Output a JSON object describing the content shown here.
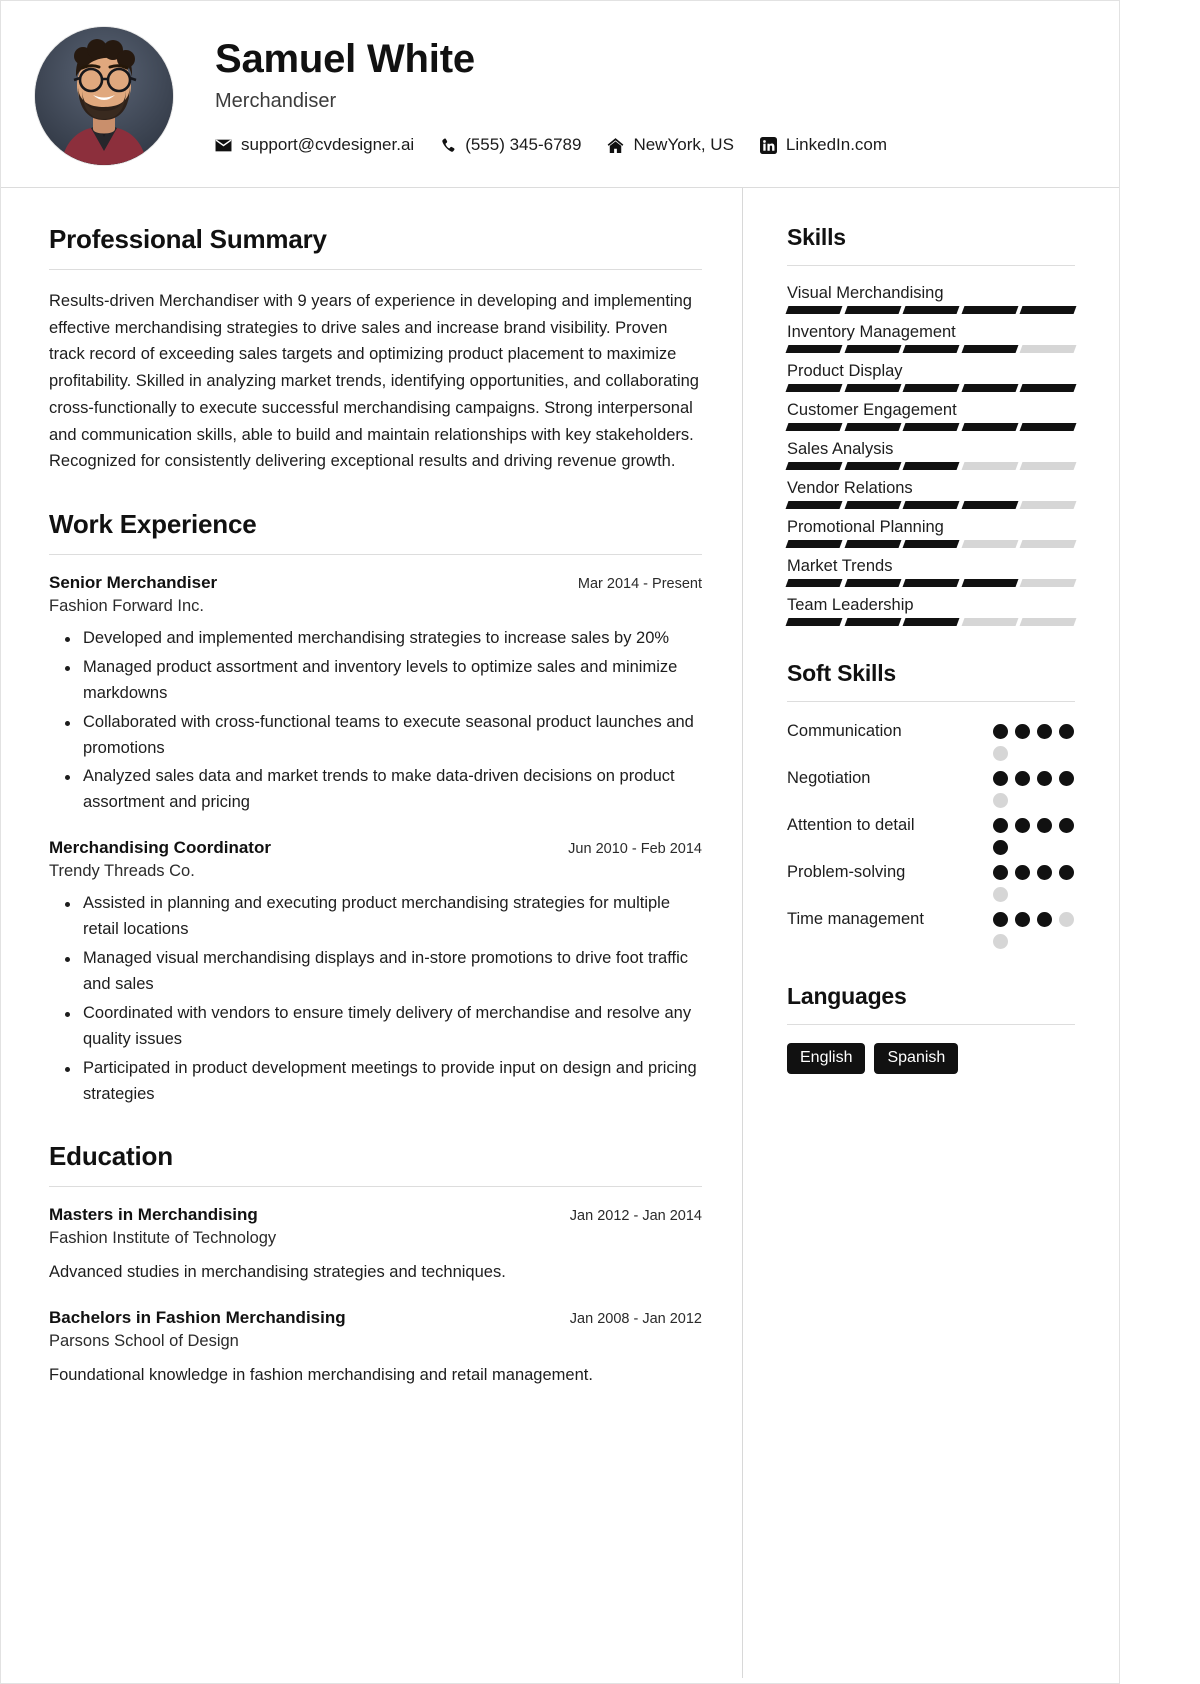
{
  "header": {
    "name": "Samuel White",
    "job_title": "Merchandiser",
    "avatar_alt": "profile-photo",
    "contacts": [
      {
        "icon": "email-icon",
        "text": "support@cvdesigner.ai"
      },
      {
        "icon": "phone-icon",
        "text": "(555) 345-6789"
      },
      {
        "icon": "home-icon",
        "text": "NewYork, US"
      },
      {
        "icon": "linkedin-icon",
        "text": "LinkedIn.com"
      }
    ]
  },
  "main": {
    "summary": {
      "title": "Professional Summary",
      "text": "Results-driven Merchandiser with 9 years of experience in developing and implementing effective merchandising strategies to drive sales and increase brand visibility. Proven track record of exceeding sales targets and optimizing product placement to maximize profitability. Skilled in analyzing market trends, identifying opportunities, and collaborating cross-functionally to execute successful merchandising campaigns. Strong interpersonal and communication skills, able to build and maintain relationships with key stakeholders. Recognized for consistently delivering exceptional results and driving revenue growth."
    },
    "work": {
      "title": "Work Experience",
      "entries": [
        {
          "role": "Senior Merchandiser",
          "date": "Mar 2014 - Present",
          "org": "Fashion Forward Inc.",
          "bullets": [
            "Developed and implemented merchandising strategies to increase sales by 20%",
            "Managed product assortment and inventory levels to optimize sales and minimize markdowns",
            "Collaborated with cross-functional teams to execute seasonal product launches and promotions",
            "Analyzed sales data and market trends to make data-driven decisions on product assortment and pricing"
          ]
        },
        {
          "role": "Merchandising Coordinator",
          "date": "Jun 2010 - Feb 2014",
          "org": "Trendy Threads Co.",
          "bullets": [
            "Assisted in planning and executing product merchandising strategies for multiple retail locations",
            "Managed visual merchandising displays and in-store promotions to drive foot traffic and sales",
            "Coordinated with vendors to ensure timely delivery of merchandise and resolve any quality issues",
            "Participated in product development meetings to provide input on design and pricing strategies"
          ]
        }
      ]
    },
    "education": {
      "title": "Education",
      "entries": [
        {
          "role": "Masters in Merchandising",
          "date": "Jan 2012 - Jan 2014",
          "org": "Fashion Institute of Technology",
          "desc": "Advanced studies in merchandising strategies and techniques."
        },
        {
          "role": "Bachelors in Fashion Merchandising",
          "date": "Jan 2008 - Jan 2012",
          "org": "Parsons School of Design",
          "desc": "Foundational knowledge in fashion merchandising and retail management."
        }
      ]
    }
  },
  "sidebar": {
    "skills": {
      "title": "Skills",
      "max": 5,
      "items": [
        {
          "name": "Visual Merchandising",
          "level": 5
        },
        {
          "name": "Inventory Management",
          "level": 4
        },
        {
          "name": "Product Display",
          "level": 5
        },
        {
          "name": "Customer Engagement",
          "level": 5
        },
        {
          "name": "Sales Analysis",
          "level": 3
        },
        {
          "name": "Vendor Relations",
          "level": 4
        },
        {
          "name": "Promotional Planning",
          "level": 3
        },
        {
          "name": "Market Trends",
          "level": 4
        },
        {
          "name": "Team Leadership",
          "level": 3
        }
      ]
    },
    "soft_skills": {
      "title": "Soft Skills",
      "max": 5,
      "items": [
        {
          "name": "Communication",
          "level": 4
        },
        {
          "name": "Negotiation",
          "level": 4
        },
        {
          "name": "Attention to detail",
          "level": 5
        },
        {
          "name": "Problem-solving",
          "level": 4
        },
        {
          "name": "Time management",
          "level": 3
        }
      ]
    },
    "languages": {
      "title": "Languages",
      "items": [
        "English",
        "Spanish"
      ]
    }
  },
  "colors": {
    "accent": "#111111",
    "muted_bar": "#d6d6d6",
    "rule": "#dddddd",
    "text": "#1d1d1d"
  }
}
